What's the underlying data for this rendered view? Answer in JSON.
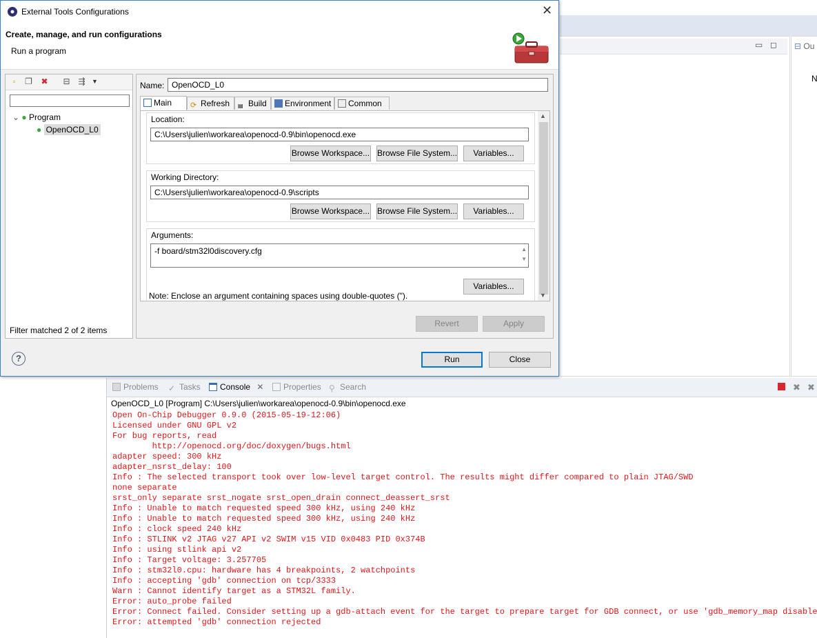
{
  "ide": {
    "right_panel_tab": "Ou",
    "right_panel_text": "N"
  },
  "dialog": {
    "title": "External Tools Configurations",
    "banner_title": "Create, manage, and run configurations",
    "banner_subtitle": "Run a program",
    "left": {
      "filter_value": "",
      "tree": [
        {
          "label": "Program",
          "expanded": true
        },
        {
          "label": "OpenOCD_L0",
          "selected": true
        }
      ],
      "status": "Filter matched 2 of 2 items"
    },
    "name_label": "Name:",
    "name_value": "OpenOCD_L0",
    "tabs": [
      "Main",
      "Refresh",
      "Build",
      "Environment",
      "Common"
    ],
    "location": {
      "label": "Location:",
      "value": "C:\\Users\\julien\\workarea\\openocd-0.9\\bin\\openocd.exe"
    },
    "working_dir": {
      "label": "Working Directory:",
      "value": "C:\\Users\\julien\\workarea\\openocd-0.9\\scripts"
    },
    "arguments": {
      "label": "Arguments:",
      "value": "-f board/stm32l0discovery.cfg"
    },
    "buttons": {
      "browse_workspace": "Browse Workspace...",
      "browse_file_system": "Browse File System...",
      "variables": "Variables...",
      "revert": "Revert",
      "apply": "Apply",
      "run": "Run",
      "close": "Close"
    },
    "note": "Note: Enclose an argument containing spaces using double-quotes (\")."
  },
  "console": {
    "tabs": [
      "Problems",
      "Tasks",
      "Console",
      "Properties",
      "Search"
    ],
    "active_tab": "Console",
    "header": "OpenOCD_L0 [Program] C:\\Users\\julien\\workarea\\openocd-0.9\\bin\\openocd.exe",
    "output": "Open On-Chip Debugger 0.9.0 (2015-05-19-12:06)\nLicensed under GNU GPL v2\nFor bug reports, read\n\thttp://openocd.org/doc/doxygen/bugs.html\nadapter speed: 300 kHz\nadapter_nsrst_delay: 100\nInfo : The selected transport took over low-level target control. The results might differ compared to plain JTAG/SWD\nnone separate\nsrst_only separate srst_nogate srst_open_drain connect_deassert_srst\nInfo : Unable to match requested speed 300 kHz, using 240 kHz\nInfo : Unable to match requested speed 300 kHz, using 240 kHz\nInfo : clock speed 240 kHz\nInfo : STLINK v2 JTAG v27 API v2 SWIM v15 VID 0x0483 PID 0x374B\nInfo : using stlink api v2\nInfo : Target voltage: 3.257705\nInfo : stm32l0.cpu: hardware has 4 breakpoints, 2 watchpoints\nInfo : accepting 'gdb' connection on tcp/3333\nWarn : Cannot identify target as a STM32L family.\nError: auto_probe failed\nError: Connect failed. Consider setting up a gdb-attach event for the target to prepare target for GDB connect, or use 'gdb_memory_map disable'.\nError: attempted 'gdb' connection rejected",
    "color": "#e4161a"
  }
}
